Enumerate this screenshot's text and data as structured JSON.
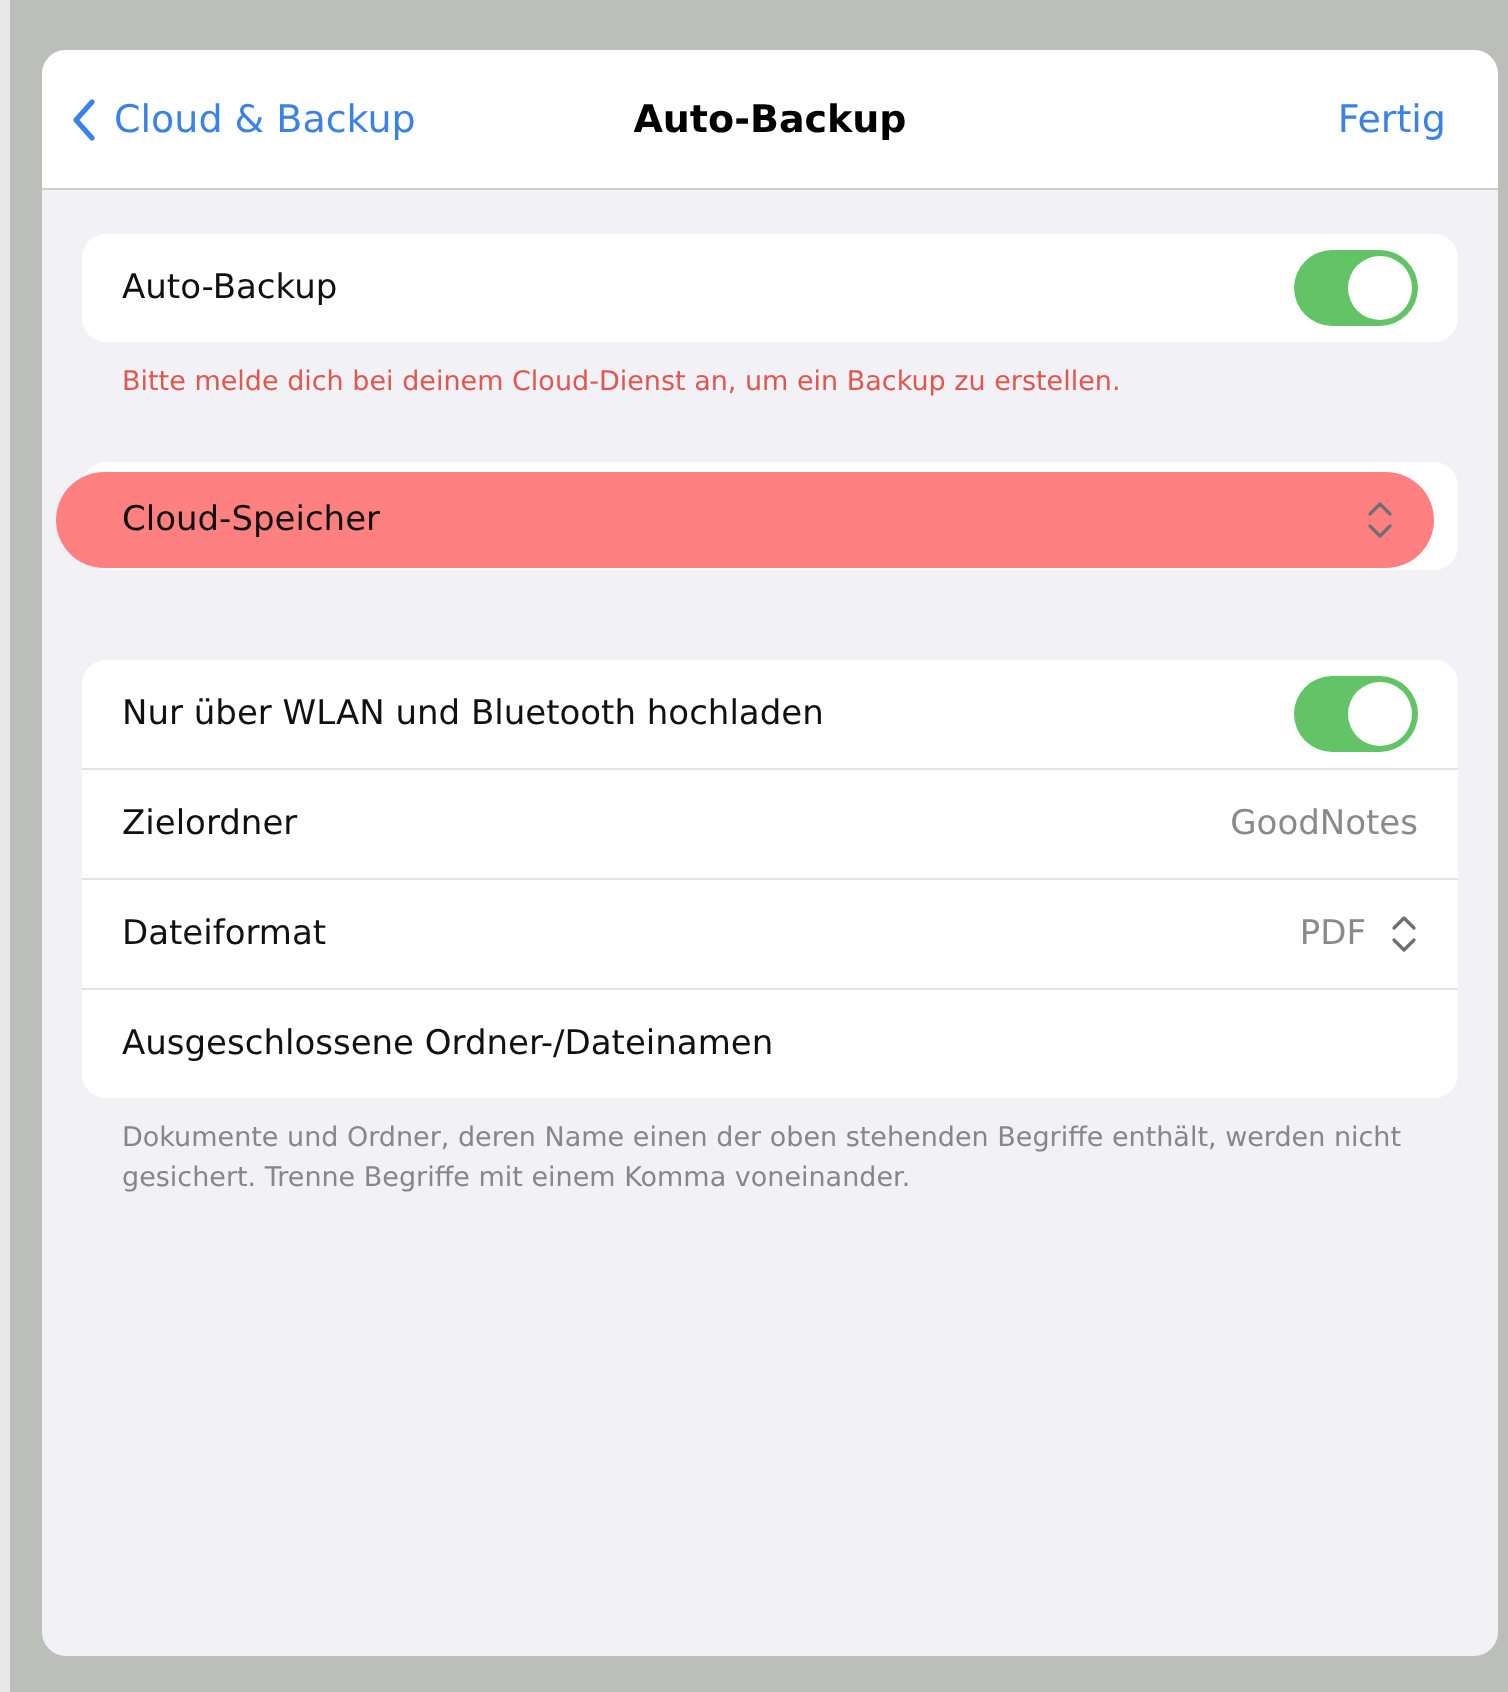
{
  "nav": {
    "back": "Cloud & Backup",
    "title": "Auto-Backup",
    "done": "Fertig"
  },
  "sections": [
    {
      "rows": [
        {
          "kind": "toggle",
          "label": "Auto-Backup",
          "on": true,
          "highlighted": false
        }
      ],
      "footer": "Bitte melde dich bei deinem Cloud-Dienst an, um ein Backup zu erstellen.",
      "footer_error": true
    },
    {
      "rows": [
        {
          "kind": "picker",
          "label": "Cloud-Speicher",
          "highlighted": true
        }
      ]
    },
    {
      "rows": [
        {
          "kind": "toggle",
          "label": "Nur über WLAN und Bluetooth hochladen",
          "on": true,
          "highlighted": false
        },
        {
          "kind": "value",
          "label": "Zielordner",
          "value": "GoodNotes",
          "highlighted": false
        },
        {
          "kind": "picker",
          "label": "Dateiformat",
          "value": "PDF",
          "highlighted": false
        },
        {
          "kind": "plain",
          "label": "Ausgeschlossene Ordner-/Dateinamen",
          "highlighted": false
        }
      ],
      "footer": "Dokumente und Ordner, deren Name einen der oben stehenden Begriffe enthält, werden nicht gesichert. Trenne Begriffe mit einem Komma voneinander.",
      "footer_error": false
    }
  ]
}
